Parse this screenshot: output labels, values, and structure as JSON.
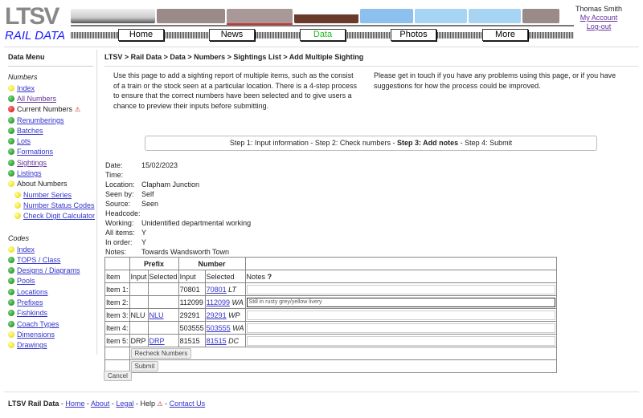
{
  "header": {
    "logo_text": "LTSV",
    "logo_sub": "RAIL DATA",
    "nav": [
      "Home",
      "News",
      "Data",
      "Photos",
      "More"
    ],
    "active_nav": "Data",
    "user_name": "Thomas Smith",
    "my_account": "My Account",
    "logout": "Log-out"
  },
  "sidebar": {
    "title": "Data Menu",
    "numbers_heading": "Numbers",
    "numbers": [
      {
        "label": "Index",
        "dot": "y",
        "link": true
      },
      {
        "label": "All Numbers",
        "dot": "g",
        "link": true,
        "visited": true
      },
      {
        "label": "Current Numbers",
        "dot": "r",
        "link": false,
        "warn": true
      },
      {
        "label": "Renumberings",
        "dot": "g",
        "link": true
      },
      {
        "label": "Batches",
        "dot": "g",
        "link": true
      },
      {
        "label": "Lots",
        "dot": "g",
        "link": true
      },
      {
        "label": "Formations",
        "dot": "g",
        "link": true
      },
      {
        "label": "Sightings",
        "dot": "g",
        "link": true,
        "visited": true
      },
      {
        "label": "Listings",
        "dot": "g",
        "link": true
      },
      {
        "label": "About Numbers",
        "dot": "y",
        "link": false
      },
      {
        "label": "Number Series",
        "dot": "y",
        "link": true,
        "sub": true
      },
      {
        "label": "Number Status Codes",
        "dot": "y",
        "link": true,
        "sub": true
      },
      {
        "label": "Check Digit Calculator",
        "dot": "y",
        "link": true,
        "sub": true
      }
    ],
    "codes_heading": "Codes",
    "codes": [
      {
        "label": "Index",
        "dot": "y"
      },
      {
        "label": "TOPS / Class",
        "dot": "g"
      },
      {
        "label": "Designs / Diagrams",
        "dot": "g"
      },
      {
        "label": "Pools",
        "dot": "g"
      },
      {
        "label": "Locations",
        "dot": "g"
      },
      {
        "label": "Prefixes",
        "dot": "g"
      },
      {
        "label": "Fishkinds",
        "dot": "g"
      },
      {
        "label": "Coach Types",
        "dot": "g"
      },
      {
        "label": "Dimensions",
        "dot": "y"
      },
      {
        "label": "Drawings",
        "dot": "y"
      }
    ]
  },
  "breadcrumb": "LTSV > Rail Data > Data > Numbers > Sightings List > Add Multiple Sighting",
  "intro": "Use this page to add a sighting report of multiple items, such as the consist of a train or the stock seen at a particular location. There is a 4-step process to ensure that the correct numbers have been selected and to give users a chance to preview their inputs before submitting.",
  "help": "Please get in touch if you have any problems using this page, or if you have suggestions for how the process could be improved.",
  "steps": {
    "s1": "Step 1: Input information",
    "s2": "Step 2: Check numbers",
    "s3": "Step 3: Add notes",
    "s4": "Step 4: Submit",
    "sep": " - "
  },
  "details": [
    [
      "Date:",
      "15/02/2023"
    ],
    [
      "Time:",
      ""
    ],
    [
      "Location:",
      "Clapham Junction"
    ],
    [
      "Seen by:",
      "Self"
    ],
    [
      "Source:",
      "Seen"
    ],
    [
      "Headcode:",
      ""
    ],
    [
      "Working:",
      "Unidentified departmental working"
    ],
    [
      "All items:",
      "Y"
    ],
    [
      "In order:",
      "Y"
    ],
    [
      "Notes:",
      "Towards Wandsworth Town"
    ]
  ],
  "table": {
    "group_prefix": "Prefix",
    "group_number": "Number",
    "headers": [
      "Item",
      "Input",
      "Selected",
      "Input",
      "Selected",
      "Notes"
    ],
    "notes_help": "?",
    "rows": [
      {
        "item": "Item 1:",
        "pin": "",
        "psel": "",
        "nin": "70801",
        "nsel": "70801",
        "code": "LT",
        "note": ""
      },
      {
        "item": "Item 2:",
        "pin": "",
        "psel": "",
        "nin": "112099",
        "nsel": "112099",
        "code": "WA",
        "note": "Still in rusty grey/yellow livery"
      },
      {
        "item": "Item 3:",
        "pin": "NLU",
        "psel": "NLU",
        "nin": "29291",
        "nsel": "29291",
        "code": "WP",
        "note": ""
      },
      {
        "item": "Item 4:",
        "pin": "",
        "psel": "",
        "nin": "503555",
        "nsel": "503555",
        "code": "WA",
        "note": ""
      },
      {
        "item": "Item 5:",
        "pin": "DRP",
        "psel": "DRP",
        "nin": "81515",
        "nsel": "81515",
        "code": "DC",
        "note": ""
      }
    ],
    "recheck": "Recheck Numbers",
    "submit": "Submit"
  },
  "cancel": "Cancel",
  "footer": {
    "brand": "LTSV Rail Data",
    "sep": " - ",
    "links": [
      "Home",
      "About",
      "Legal"
    ],
    "help": "Help",
    "contact": "Contact Us"
  }
}
